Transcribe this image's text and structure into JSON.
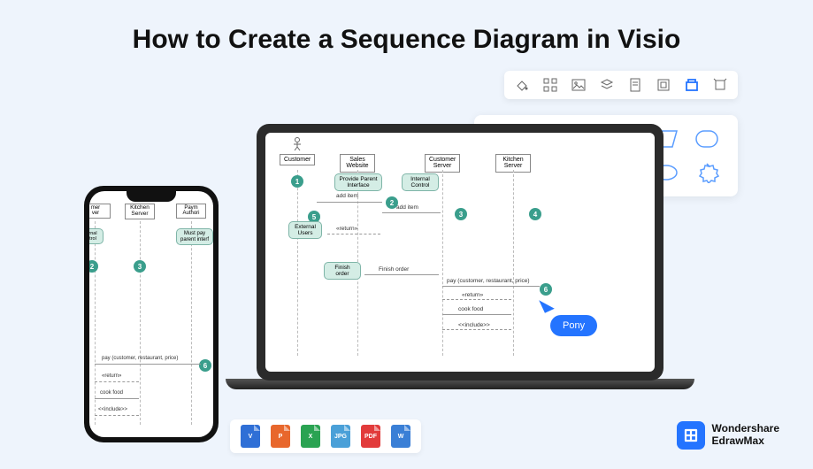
{
  "title": "How to Create a Sequence Diagram in Visio",
  "toolbar": [
    "fill",
    "grid",
    "image",
    "layers",
    "page",
    "snap",
    "container",
    "frame"
  ],
  "shapes_row1": [
    "rect",
    "circle",
    "roundrect",
    "triangle",
    "para",
    "roundrect2"
  ],
  "shapes_row2": [
    "hexagon",
    "star",
    "burst",
    "diamond",
    "ellipse",
    "seal"
  ],
  "lanes": {
    "customer": "Customer",
    "sales": "Sales Website",
    "cserver": "Customer Server",
    "kitchen": "Kitchen Server",
    "payauth": "Payment Authorize"
  },
  "nodes": {
    "parent_iface": "Provide Parent Interface",
    "internal_ctrl": "Internal Control",
    "ext_users": "External Users",
    "must_pay": "Must pay parent interf"
  },
  "messages": {
    "add_item": "add item",
    "return": "«return»",
    "finish_order": "Finish order",
    "pay": "pay (customer, restaurant, price)",
    "cook_food": "cook food",
    "include": "<<include>>"
  },
  "badges": {
    "b1": "1",
    "b2": "2",
    "b3": "3",
    "b4": "4",
    "b5": "5",
    "b6": "6"
  },
  "cursor_label": "Pony",
  "files": [
    {
      "label": "V",
      "color": "#2f6fd6"
    },
    {
      "label": "P",
      "color": "#e8672c"
    },
    {
      "label": "X",
      "color": "#2aa352"
    },
    {
      "label": "JPG",
      "color": "#4aa0d8"
    },
    {
      "label": "PDF",
      "color": "#e23b3b"
    },
    {
      "label": "W",
      "color": "#3a7fd6"
    }
  ],
  "brand": {
    "line1": "Wondershare",
    "line2": "EdrawMax"
  }
}
